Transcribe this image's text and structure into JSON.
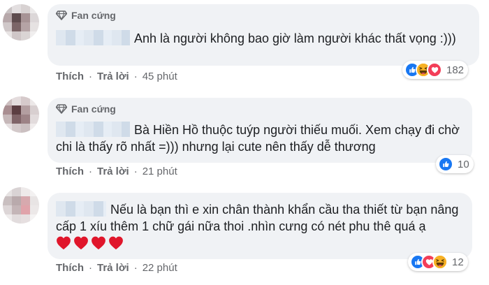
{
  "colors": {
    "like": "#1877f2",
    "love": "#f33e58",
    "haha": "#f7b125",
    "bubble": "#f0f2f5",
    "meta": "#65676b"
  },
  "comments": [
    {
      "badge": "Fan cứng",
      "badge_icon": "diamond-icon",
      "text": "Anh là người không bao giờ làm người khác thất vọng :)))",
      "like_label": "Thích",
      "reply_label": "Trả lời",
      "separator": "·",
      "time": "45 phút",
      "reactions": [
        "like",
        "haha",
        "love"
      ],
      "reaction_count": "182"
    },
    {
      "badge": "Fan cứng",
      "badge_icon": "diamond-icon",
      "text": "Bà Hiền Hồ thuộc tuýp người thiếu muối. Xem chạy đi chờ chi là thấy rõ nhất =))) nhưng lại cute nên thấy dễ thương",
      "like_label": "Thích",
      "reply_label": "Trả lời",
      "separator": "·",
      "time": "21 phút",
      "reactions": [
        "like"
      ],
      "reaction_count": "10"
    },
    {
      "text": "Nếu là bạn thì e xin chân thành khẩn cầu tha thiết từ bạn nâng cấp 1 xíu thêm 1 chữ gái nữa thoi .nhìn cưng có nét phu thê quá ạ",
      "emoji": "❤️❤️❤️❤️",
      "like_label": "Thích",
      "reply_label": "Trả lời",
      "separator": "·",
      "time": "22 phút",
      "reactions": [
        "like",
        "love",
        "haha"
      ],
      "reaction_count": "12"
    }
  ]
}
